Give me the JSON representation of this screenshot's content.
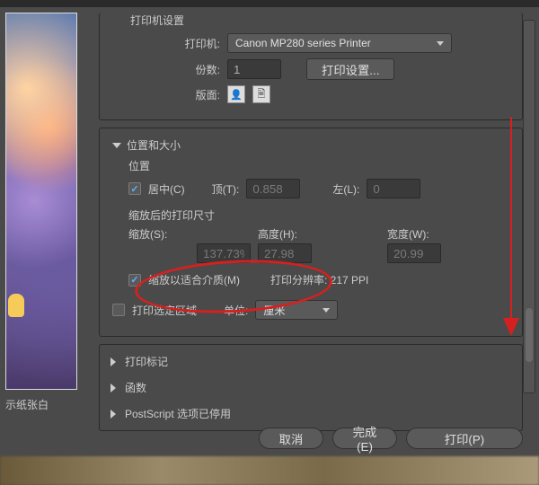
{
  "preview": {
    "below_text": "示纸张白"
  },
  "printer_group": {
    "title": "打印机设置",
    "printer_label": "打印机:",
    "printer_value": "Canon MP280 series Printer",
    "copies_label": "份数:",
    "copies_value": "1",
    "print_settings_btn": "打印设置...",
    "layout_label": "版面:",
    "icon1": "👤",
    "icon2": "🖹"
  },
  "position_group": {
    "title": "位置和大小",
    "position_label": "位置",
    "center_label": "居中(C)",
    "top_label": "顶(T):",
    "top_value": "0.858",
    "left_label": "左(L):",
    "left_value": "0",
    "scaled_size_label": "缩放后的打印尺寸",
    "scale_label": "缩放(S):",
    "scale_value": "137.73%",
    "height_label": "高度(H):",
    "height_value": "27.98",
    "width_label": "宽度(W):",
    "width_value": "20.99",
    "fit_media_label": "缩放以适合介质(M)",
    "resolution_label": "打印分辨率: 217 PPI",
    "print_selected_label": "打印选定区域",
    "units_label": "单位:",
    "units_value": "厘米"
  },
  "collapsed": {
    "marks": "打印标记",
    "functions": "函数",
    "postscript": "PostScript 选项已停用"
  },
  "footer": {
    "cancel": "取消",
    "done": "完成(E)",
    "print": "打印(P)"
  }
}
